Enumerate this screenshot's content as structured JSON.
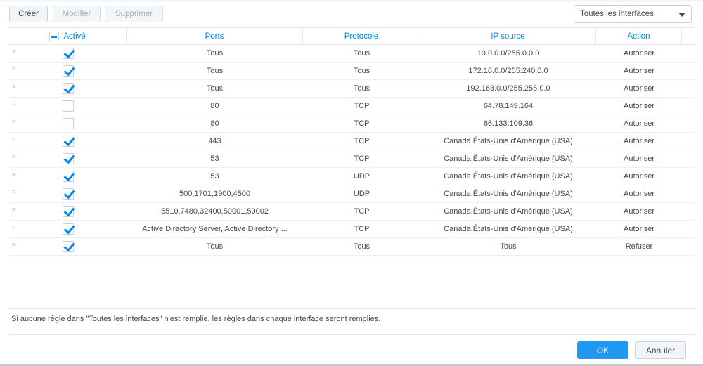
{
  "toolbar": {
    "create": "Créer",
    "modify": "Modifier",
    "delete": "Supprimer",
    "interface_select": "Toutes les interfaces"
  },
  "columns": {
    "enabled": "Activé",
    "ports": "Ports",
    "protocol": "Protocole",
    "source_ip": "IP source",
    "action": "Action"
  },
  "rows": [
    {
      "enabled": true,
      "ports": "Tous",
      "protocol": "Tous",
      "source_ip": "10.0.0.0/255.0.0.0",
      "action": "Autoriser"
    },
    {
      "enabled": true,
      "ports": "Tous",
      "protocol": "Tous",
      "source_ip": "172.16.0.0/255.240.0.0",
      "action": "Autoriser"
    },
    {
      "enabled": true,
      "ports": "Tous",
      "protocol": "Tous",
      "source_ip": "192.168.0.0/255.255.0.0",
      "action": "Autoriser"
    },
    {
      "enabled": false,
      "ports": "80",
      "protocol": "TCP",
      "source_ip": "64.78.149.164",
      "action": "Autoriser"
    },
    {
      "enabled": false,
      "ports": "80",
      "protocol": "TCP",
      "source_ip": "66.133.109.36",
      "action": "Autoriser"
    },
    {
      "enabled": true,
      "ports": "443",
      "protocol": "TCP",
      "source_ip": "Canada,États-Unis d'Amérique (USA)",
      "action": "Autoriser"
    },
    {
      "enabled": true,
      "ports": "53",
      "protocol": "TCP",
      "source_ip": "Canada,États-Unis d'Amérique (USA)",
      "action": "Autoriser"
    },
    {
      "enabled": true,
      "ports": "53",
      "protocol": "UDP",
      "source_ip": "Canada,États-Unis d'Amérique (USA)",
      "action": "Autoriser"
    },
    {
      "enabled": true,
      "ports": "500,1701,1900,4500",
      "protocol": "UDP",
      "source_ip": "Canada,États-Unis d'Amérique (USA)",
      "action": "Autoriser"
    },
    {
      "enabled": true,
      "ports": "5510,7480,32400,50001,50002",
      "protocol": "TCP",
      "source_ip": "Canada,États-Unis d'Amérique (USA)",
      "action": "Autoriser"
    },
    {
      "enabled": true,
      "ports": "Active Directory Server, Active Directory ...",
      "protocol": "TCP",
      "source_ip": "Canada,États-Unis d'Amérique (USA)",
      "action": "Autoriser"
    },
    {
      "enabled": true,
      "ports": "Tous",
      "protocol": "Tous",
      "source_ip": "Tous",
      "action": "Refuser"
    }
  ],
  "note": "Si aucune règle dans \"Toutes les interfaces\" n'est remplie, les règles dans chaque interface seront remplies.",
  "footer": {
    "ok": "OK",
    "cancel": "Annuler"
  }
}
